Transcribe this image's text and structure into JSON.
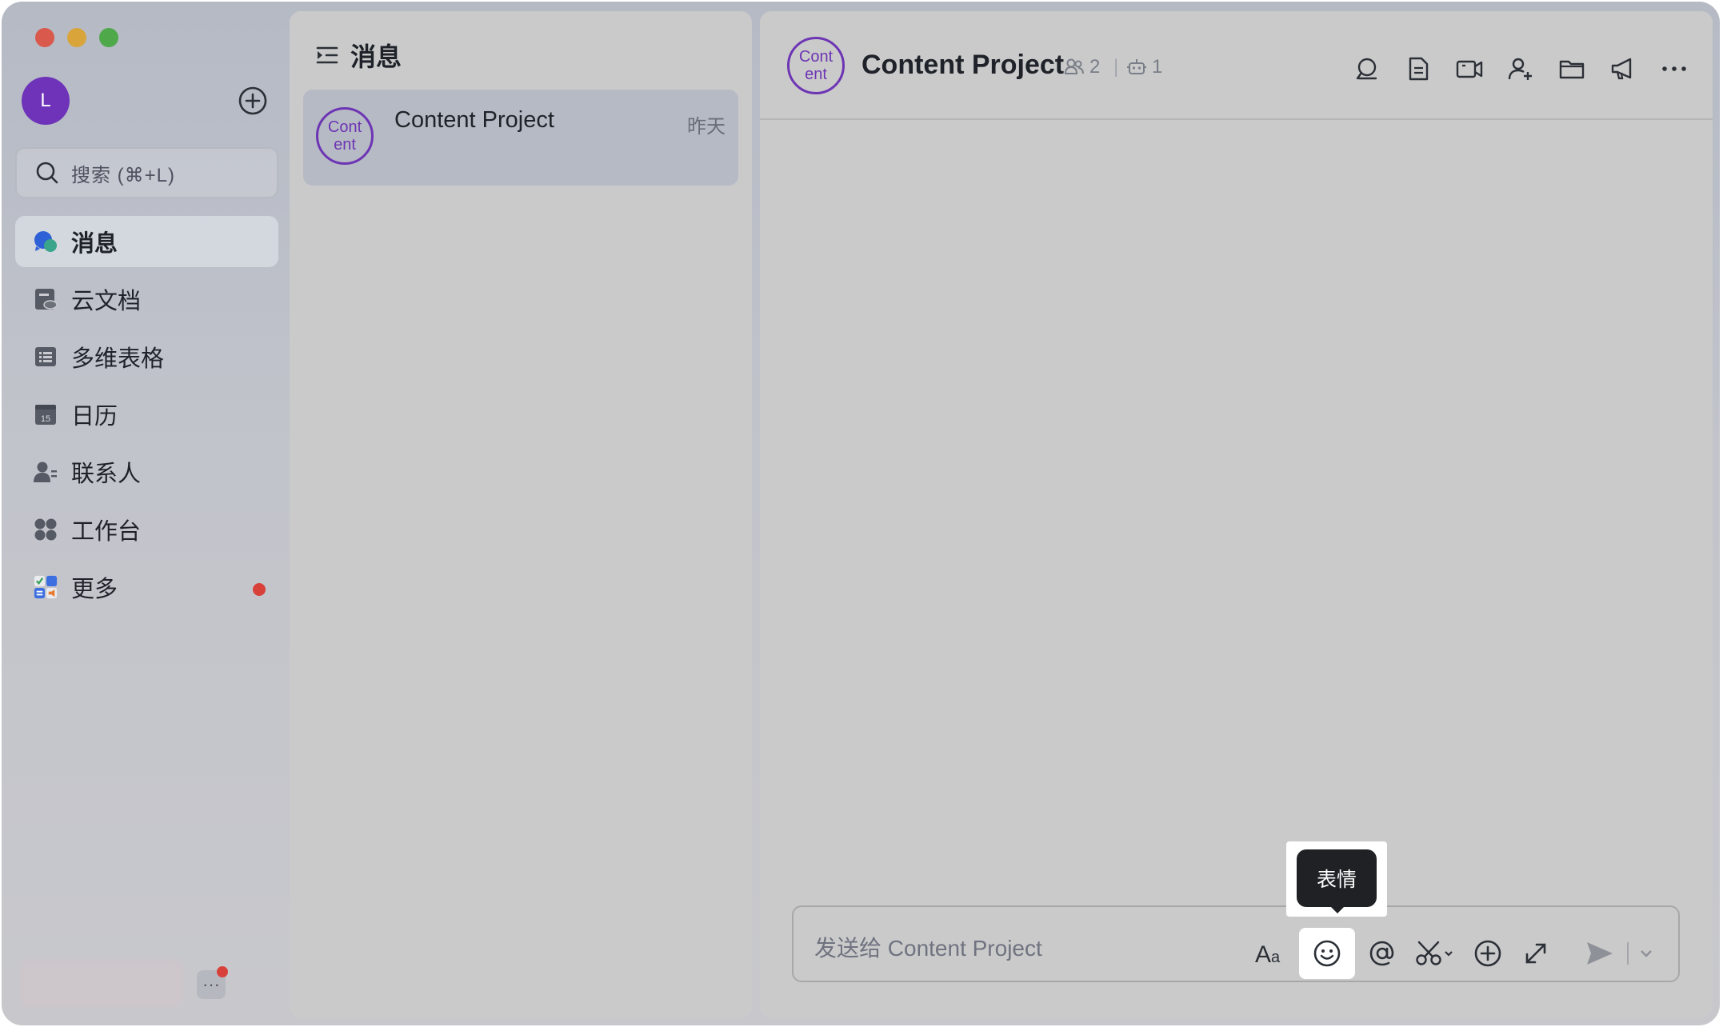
{
  "window": {
    "controls": [
      "close",
      "minimize",
      "zoom"
    ]
  },
  "sidebar": {
    "avatar_initial": "L",
    "search_placeholder": "搜索 (⌘+L)",
    "items": [
      {
        "label": "消息",
        "icon": "message-bubble-icon",
        "active": true
      },
      {
        "label": "云文档",
        "icon": "cloud-doc-icon"
      },
      {
        "label": "多维表格",
        "icon": "base-table-icon"
      },
      {
        "label": "日历",
        "icon": "calendar-icon",
        "icon_text": "15"
      },
      {
        "label": "联系人",
        "icon": "contacts-icon"
      },
      {
        "label": "工作台",
        "icon": "workplace-icon"
      },
      {
        "label": "更多",
        "icon": "more-apps-icon",
        "has_badge": true
      }
    ],
    "bottom_more": "···"
  },
  "list": {
    "title": "消息",
    "items": [
      {
        "avatar_line1": "Cont",
        "avatar_line2": "ent",
        "name": "Content Project",
        "time": "昨天"
      }
    ]
  },
  "chat": {
    "avatar_line1": "Cont",
    "avatar_line2": "ent",
    "title": "Content Project",
    "member_count": "2",
    "bot_count": "1",
    "header_icons": [
      "search-icon",
      "doc-icon",
      "video-icon",
      "add-member-icon",
      "folder-icon",
      "announcement-icon",
      "more-icon"
    ],
    "composer_placeholder": "发送给 Content Project",
    "tool_icons": [
      "font-style-icon",
      "emoji-icon",
      "mention-icon",
      "screenshot-icon",
      "add-icon",
      "expand-icon",
      "send-icon"
    ],
    "tooltip": "表情"
  },
  "colors": {
    "accent_purple": "#6d35b4",
    "badge_red": "#d8413a",
    "tooltip_bg": "#1f2124"
  }
}
